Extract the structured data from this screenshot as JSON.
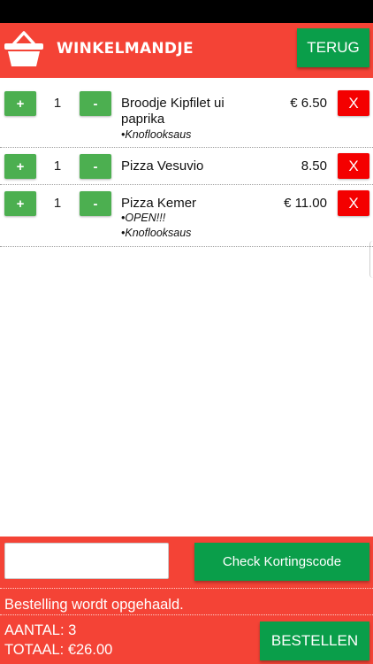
{
  "header": {
    "title": "WINKELMANDJE",
    "back_label": "TERUG",
    "icon": "shopping-basket-icon"
  },
  "cart": {
    "items": [
      {
        "plus": "+",
        "minus": "-",
        "qty": "1",
        "name": "Broodje Kipfilet ui paprika",
        "options": [
          "•Knoflooksaus"
        ],
        "price": "€ 6.50",
        "remove": "X"
      },
      {
        "plus": "+",
        "minus": "-",
        "qty": "1",
        "name": "Pizza Vesuvio",
        "options": [],
        "price": "8.50",
        "remove": "X"
      },
      {
        "plus": "+",
        "minus": "-",
        "qty": "1",
        "name": "Pizza Kemer",
        "options": [
          "•OPEN!!!",
          "•Knoflooksaus"
        ],
        "price": "€ 11.00",
        "remove": "X"
      }
    ]
  },
  "footer": {
    "code_placeholder": "",
    "check_label": "Check Kortingscode",
    "pickup_text": "Bestelling wordt opgehaald.",
    "count_text": "AANTAL: 3",
    "total_text": "TOTAAL: €26.00",
    "order_label": "BESTELLEN"
  },
  "colors": {
    "accent_red": "#f44336",
    "action_green": "#0a9e4a",
    "stepper_green": "#4caf50",
    "remove_red": "#f40000"
  }
}
